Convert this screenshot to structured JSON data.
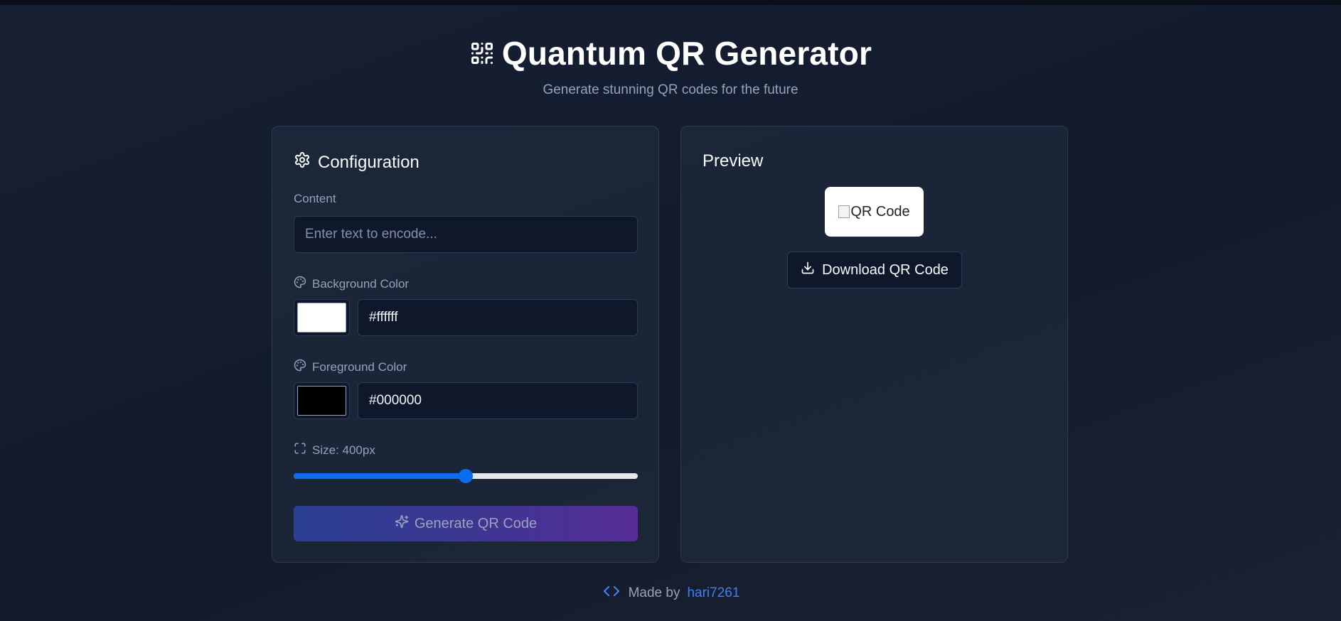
{
  "header": {
    "title": "Quantum QR Generator",
    "subtitle": "Generate stunning QR codes for the future",
    "icon": "qr-code-icon"
  },
  "config": {
    "title": "Configuration",
    "icon": "gear-icon",
    "content": {
      "label": "Content",
      "placeholder": "Enter text to encode...",
      "value": ""
    },
    "background": {
      "label": "Background Color",
      "icon": "palette-icon",
      "value": "#ffffff"
    },
    "foreground": {
      "label": "Foreground Color",
      "icon": "palette-icon",
      "value": "#000000"
    },
    "size": {
      "label": "Size: 400px",
      "icon": "expand-icon",
      "value": 400,
      "fraction": 0.5
    },
    "generate_label": "Generate QR Code",
    "generate_icon": "sparkles-icon"
  },
  "preview": {
    "title": "Preview",
    "image_alt": "QR Code",
    "download_label": "Download QR Code",
    "download_icon": "download-icon"
  },
  "footer": {
    "icon": "code-icon",
    "text": "Made by",
    "author": "hari7261"
  },
  "colors": {
    "accent": "#0b6cf0",
    "link": "#3b82f6",
    "background": "#131b2d"
  }
}
